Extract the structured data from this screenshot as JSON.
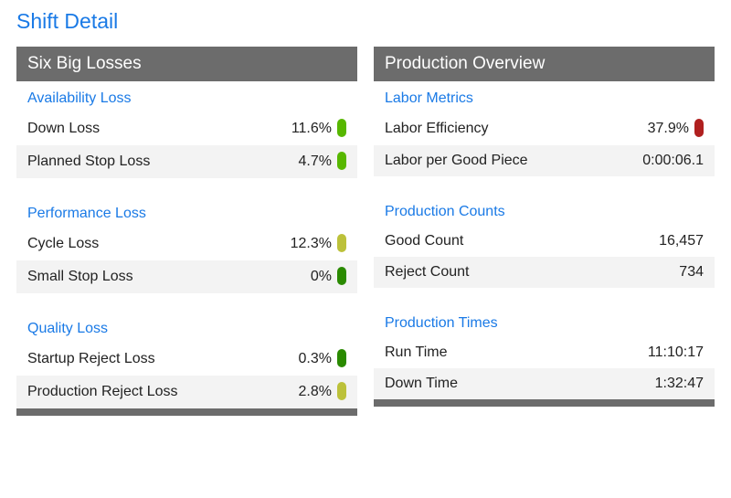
{
  "title": "Shift Detail",
  "colors": {
    "good": "#57b700",
    "warn": "#bcc13a",
    "bad": "#b0201f",
    "darkgreen": "#2a8a00"
  },
  "left_panel": {
    "header": "Six Big Losses",
    "sections": [
      {
        "title": "Availability Loss",
        "rows": [
          {
            "label": "Down Loss",
            "value": "11.6%",
            "pill": "good"
          },
          {
            "label": "Planned Stop Loss",
            "value": "4.7%",
            "pill": "good"
          }
        ]
      },
      {
        "title": "Performance Loss",
        "rows": [
          {
            "label": "Cycle Loss",
            "value": "12.3%",
            "pill": "warn"
          },
          {
            "label": "Small Stop Loss",
            "value": "0%",
            "pill": "darkgreen"
          }
        ]
      },
      {
        "title": "Quality Loss",
        "rows": [
          {
            "label": "Startup Reject Loss",
            "value": "0.3%",
            "pill": "darkgreen"
          },
          {
            "label": "Production Reject Loss",
            "value": "2.8%",
            "pill": "warn"
          }
        ]
      }
    ]
  },
  "right_panel": {
    "header": "Production Overview",
    "sections": [
      {
        "title": "Labor Metrics",
        "rows": [
          {
            "label": "Labor Efficiency",
            "value": "37.9%",
            "pill": "bad"
          },
          {
            "label": "Labor per Good Piece",
            "value": "0:00:06.1"
          }
        ]
      },
      {
        "title": "Production Counts",
        "rows": [
          {
            "label": "Good Count",
            "value": "16,457"
          },
          {
            "label": "Reject Count",
            "value": "734"
          }
        ]
      },
      {
        "title": "Production Times",
        "rows": [
          {
            "label": "Run Time",
            "value": "11:10:17"
          },
          {
            "label": "Down Time",
            "value": "1:32:47"
          }
        ]
      }
    ]
  }
}
